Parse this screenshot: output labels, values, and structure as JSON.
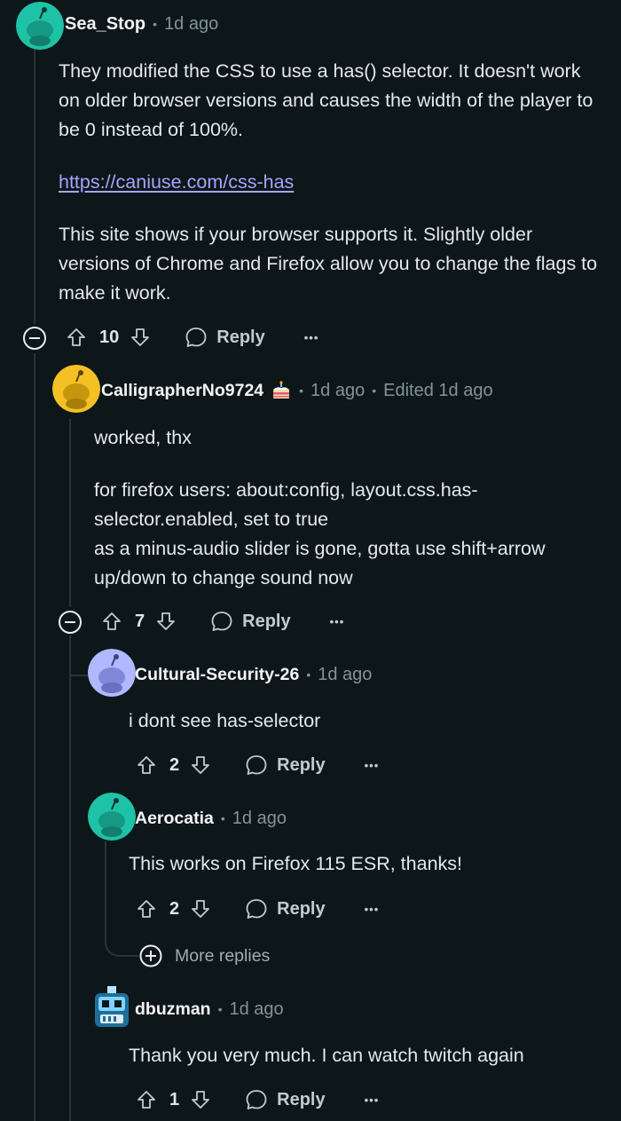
{
  "colors": {
    "background": "#0d1619",
    "meta": "#82939b",
    "link": "#a3a6ff",
    "avatar_teal": "#1ec2a6",
    "avatar_yellow": "#f5c024",
    "avatar_lavender": "#b1b8ff"
  },
  "comments": [
    {
      "author": "Sea_Stop",
      "time": "1d ago",
      "paragraphs": [
        "They modified the CSS to use a has() selector. It doesn't work on older browser versions and causes the width of the player to be 0 instead of 100%."
      ],
      "link": "https://caniuse.com/css-has",
      "paragraphs2": [
        "This site shows if your browser supports it. Slightly older versions of Chrome and Firefox allow you to change the flags to make it work."
      ],
      "votes": "10",
      "reply_label": "Reply",
      "more_label": "•••"
    },
    {
      "author": "CalligrapherNo9724",
      "time": "1d ago",
      "edited": "Edited 1d ago",
      "paragraphs": [
        "worked, thx"
      ],
      "lines": [
        "for firefox users: about:config, layout.css.has-selector.enabled, set to true",
        "as a minus-audio slider is gone, gotta use shift+arrow up/down to change sound now"
      ],
      "votes": "7",
      "reply_label": "Reply",
      "more_label": "•••"
    },
    {
      "author": "Cultural-Security-26",
      "time": "1d ago",
      "text": "i dont see has-selector",
      "votes": "2",
      "reply_label": "Reply",
      "more_label": "•••"
    },
    {
      "author": "Aerocatia",
      "time": "1d ago",
      "text": "This works on Firefox 115 ESR, thanks!",
      "votes": "2",
      "reply_label": "Reply",
      "more_label": "•••"
    },
    {
      "author": "dbuzman",
      "time": "1d ago",
      "text": "Thank you very much. I can watch twitch again",
      "votes": "1",
      "reply_label": "Reply",
      "more_label": "•••"
    }
  ],
  "more_replies_label": "More replies",
  "icons": [
    "collapse-icon",
    "upvote-icon",
    "downvote-icon",
    "reply-icon",
    "more-options-icon",
    "expand-icon",
    "cake-icon"
  ]
}
